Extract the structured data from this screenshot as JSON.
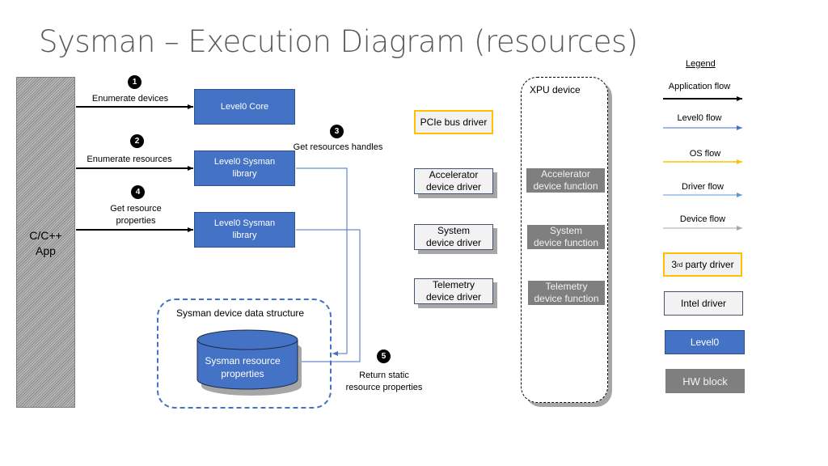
{
  "title": "Sysman – Execution Diagram (resources)",
  "app": {
    "label_line1": "C/C++",
    "label_line2": "App"
  },
  "steps": [
    {
      "number": "1",
      "label": "Enumerate devices"
    },
    {
      "number": "2",
      "label": "Enumerate resources"
    },
    {
      "number": "3",
      "label": "Get resources handles"
    },
    {
      "number": "4",
      "label_line1": "Get resource",
      "label_line2": "properties"
    },
    {
      "number": "5",
      "label_line1": "Return static",
      "label_line2": "resource properties"
    }
  ],
  "level0_blocks": {
    "core": "Level0 Core",
    "sysman1_line1": "Level0 Sysman",
    "sysman1_line2": "library",
    "sysman2_line1": "Level0 Sysman",
    "sysman2_line2": "library"
  },
  "data_structure": {
    "label": "Sysman device data structure",
    "store_line1": "Sysman resource",
    "store_line2": "properties"
  },
  "drivers": {
    "pcie": "PCIe bus driver",
    "accelerator_line1": "Accelerator",
    "accelerator_line2": "device driver",
    "system_line1": "System",
    "system_line2": "device driver",
    "telemetry_line1": "Telemetry",
    "telemetry_line2": "device driver"
  },
  "xpu": {
    "label": "XPU device",
    "accelerator_line1": "Accelerator",
    "accelerator_line2": "device function",
    "system_line1": "System",
    "system_line2": "device function",
    "telemetry_line1": "Telemetry",
    "telemetry_line2": "device function"
  },
  "legend": {
    "title": "Legend",
    "flows": [
      {
        "label": "Application flow",
        "color": "#000000"
      },
      {
        "label": "Level0 flow",
        "color": "#4472c4"
      },
      {
        "label": "OS flow",
        "color": "#ffc000"
      },
      {
        "label": "Driver flow",
        "color": "#5b9bd5"
      },
      {
        "label": "Device flow",
        "color": "#a6a6a6"
      }
    ],
    "third_party_sup": "rd",
    "third_party_pre": "3",
    "third_party_post": " party driver",
    "intel_driver": "Intel driver",
    "level0": "Level0",
    "hw_block": "HW block"
  },
  "colors": {
    "level0_blue": "#4472c4",
    "os_yellow": "#ffc000",
    "hw_gray": "#7f7f7f"
  }
}
